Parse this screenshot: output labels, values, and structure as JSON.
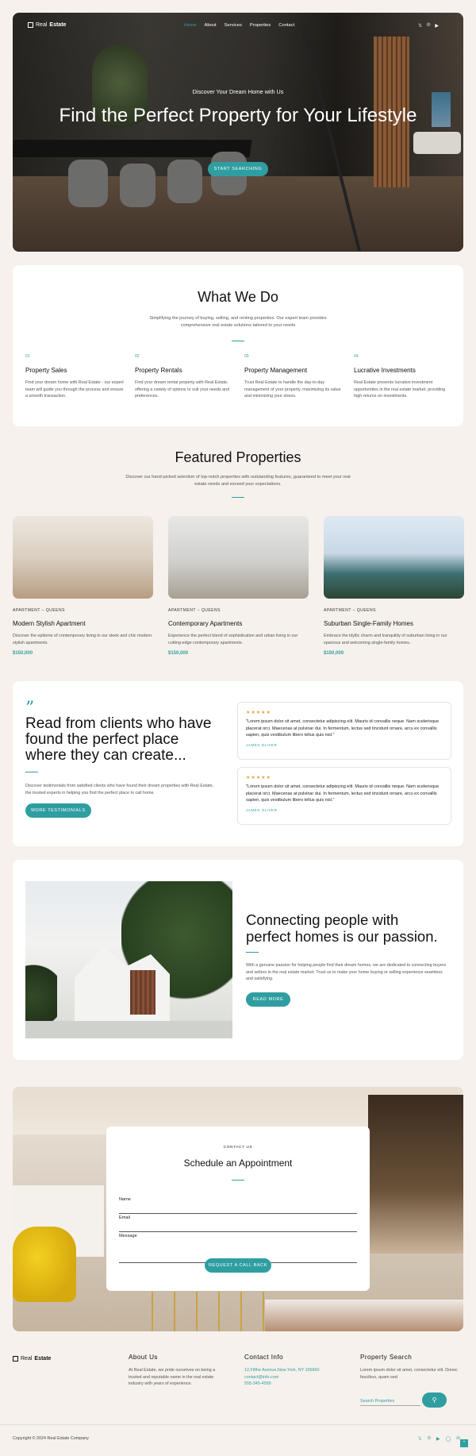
{
  "brand": {
    "light": "Real",
    "bold": "Estate",
    "accent": "#2f9ea1"
  },
  "nav": {
    "items": [
      "Home",
      "About",
      "Services",
      "Properties",
      "Contact"
    ],
    "active": "Home"
  },
  "social": [
    "twitter-icon",
    "pinterest-icon",
    "youtube-icon"
  ],
  "hero": {
    "subtitle": "Discover Your Dream Home with Us",
    "title": "Find the Perfect Property for Your Lifestyle",
    "button": "Start Searching"
  },
  "what_we_do": {
    "title": "What We Do",
    "intro": "Simplifying the journey of buying, selling, and renting properties. Our expert team provides comprehensive real estate solutions tailored to your needs",
    "services": [
      {
        "num": "01",
        "title": "Property Sales",
        "desc": "Find your dream home with Real Estate - our expert team will guide you through the process and ensure a smooth transaction."
      },
      {
        "num": "02",
        "title": "Property Rentals",
        "desc": "Find your dream rental property with Real Estate, offering a variety of options to suit your needs and preferences."
      },
      {
        "num": "03",
        "title": "Property Management",
        "desc": "Trust Real Estate to handle the day-to-day management of your property, maximizing its value and minimizing your stress."
      },
      {
        "num": "04",
        "title": "Lucrative Investments",
        "desc": "Real Estate presents lucrative investment opportunities in the real estate market, providing high returns on investments."
      }
    ]
  },
  "featured": {
    "title": "Featured Properties",
    "intro": "Discover our hand-picked selection of top-notch properties with outstanding features, guaranteed to meet your real estate needs and exceed your expectations.",
    "items": [
      {
        "tag": "APARTMENT – QUEENS",
        "name": "Modern Stylish Apartment",
        "desc": "Discover the epitome of contemporary living in our sleek and chic modern stylish apartments.",
        "price": "$150,000"
      },
      {
        "tag": "APARTMENT – QUEENS",
        "name": "Contemporary Apartments",
        "desc": "Experience the perfect blend of sophistication and urban living in our cutting-edge contemporary apartments.",
        "price": "$150,000"
      },
      {
        "tag": "APARTMENT – QUEENS",
        "name": "Suburban Single-Family Homes",
        "desc": "Embrace the idyllic charm and tranquility of suburban living in our spacious and welcoming single-family homes.",
        "price": "$150,000"
      }
    ]
  },
  "testimonials": {
    "quote_mark": "”",
    "title": "Read from clients who have found the perfect place where they can create...",
    "desc": "Discover testimonials from satisfied clients who have found their dream properties with Real Estate, the trusted experts in helping you find the perfect place to call home.",
    "button": "More Testimonials",
    "reviews": [
      {
        "stars": "★★★★★",
        "text": "\"Lorem ipsum dolor sit amet, consectetur adipiscing elit. Mauris id convallis neque. Nam scelerisque placerat orci. Maecenas at pulvinar dui. In fermentum, lectus sed tincidunt ornare, arcu ex convallis sapien, quis vestibulum libero tellus quis nisl.\"",
        "name": "JAMES OLIVER"
      },
      {
        "stars": "★★★★★",
        "text": "\"Lorem ipsum dolor sit amet, consectetur adipiscing elit. Mauris id convallis neque. Nam scelerisque placerat orci. Maecenas at pulvinar dui. In fermentum, lectus sed tincidunt ornare, arcu ex convallis sapien, quis vestibulum libero tellus quis nisl.\"",
        "name": "JAMES OLIVER"
      }
    ]
  },
  "about": {
    "title": "Connecting people with perfect homes is our passion.",
    "desc": "With a genuine passion for helping people find their dream homes, we are dedicated to connecting buyers and sellers in the real estate market. Trust us to make your home buying or selling experience seamless and satisfying.",
    "button": "Read More"
  },
  "appointment": {
    "label": "CONTACT US",
    "title": "Schedule an Appointment",
    "fields": {
      "name": "Name",
      "email": "Email",
      "message": "Message"
    },
    "button": "Request a Call Back"
  },
  "footer": {
    "about": {
      "title": "About Us",
      "text": "At Real Estate, we pride ourselves on being a trusted and reputable name in the real estate industry with years of experience."
    },
    "contact": {
      "title": "Contact Info",
      "address": "12,Fifthe Avenue,New York, NY 105660",
      "email": "contact@info.com",
      "phone": "555-345-4599"
    },
    "search": {
      "title": "Property Search",
      "text": "Lorem ipsum dolor sit amet, consectetur elit. Donec faucibus, quam sed.",
      "placeholder": "Search Properties"
    },
    "copyright": "Copyright © 2024 Real Estate Company",
    "social": [
      "twitter-icon",
      "pinterest-icon",
      "youtube-icon",
      "instagram-icon",
      "linkedin-icon"
    ]
  }
}
